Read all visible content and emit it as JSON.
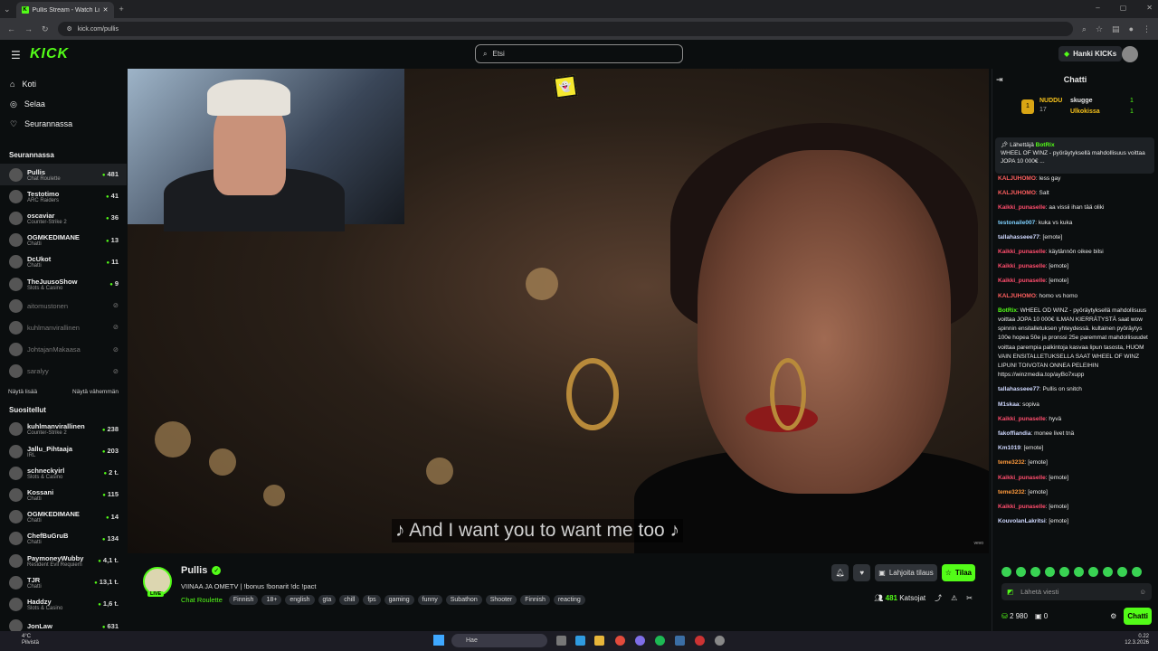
{
  "browser": {
    "tab_title": "Pullis Stream - Watch Live ...",
    "url": "kick.com/pullis"
  },
  "header": {
    "logo": "KICK",
    "search_placeholder": "Etsi",
    "kicks_button": "Hanki KICKs"
  },
  "sidebar": {
    "nav": [
      {
        "label": "Koti",
        "icon": "home-icon"
      },
      {
        "label": "Selaa",
        "icon": "compass-icon"
      },
      {
        "label": "Seurannassa",
        "icon": "heart-icon"
      }
    ],
    "following_header": "Seurannassa",
    "following": [
      {
        "name": "Pullis",
        "sub": "Chat Roulette",
        "count": "481",
        "active": true
      },
      {
        "name": "Testotimo",
        "sub": "ARC Raiders",
        "count": "41"
      },
      {
        "name": "oscaviar",
        "sub": "Counter-Strike 2",
        "count": "36"
      },
      {
        "name": "OGMKEDIMANE",
        "sub": "Chatti",
        "count": "13"
      },
      {
        "name": "DcUkot",
        "sub": "Chatti",
        "count": "11"
      },
      {
        "name": "TheJuusoShow",
        "sub": "Slots & Casino",
        "count": "9"
      },
      {
        "name": "aitomustonen",
        "sub": "",
        "count": "",
        "offline": true
      },
      {
        "name": "kuhlmanvirallinen",
        "sub": "",
        "count": "",
        "offline": true
      },
      {
        "name": "JohtajanMakaasa",
        "sub": "",
        "count": "",
        "offline": true
      },
      {
        "name": "saralyy",
        "sub": "",
        "count": "",
        "offline": true
      }
    ],
    "show_more": "Näytä lisää",
    "show_less": "Näytä vähemmän",
    "recommended_header": "Suositellut",
    "recommended": [
      {
        "name": "kuhlmanvirallinen",
        "sub": "Counter-Strike 2",
        "count": "238"
      },
      {
        "name": "Jallu_Pihtaaja",
        "sub": "IRL",
        "count": "203"
      },
      {
        "name": "schneckyirl",
        "sub": "Slots & Casino",
        "count": "2 t."
      },
      {
        "name": "Kossani",
        "sub": "Chatti",
        "count": "115"
      },
      {
        "name": "OGMKEDIMANE",
        "sub": "Chatti",
        "count": "14"
      },
      {
        "name": "ChefBuGruB",
        "sub": "Chatti",
        "count": "134"
      },
      {
        "name": "PaymoneyWubby",
        "sub": "Resident Evil Requiem",
        "count": "4,1 t."
      },
      {
        "name": "TJR",
        "sub": "Chatti",
        "count": "13,1 t."
      },
      {
        "name": "Haddzy",
        "sub": "Slots & Casino",
        "count": "1,6 t."
      },
      {
        "name": "JonLaw",
        "sub": "",
        "count": "631"
      }
    ]
  },
  "video": {
    "subtitle": "♪ And I want you to want me too ♪",
    "watermark": "vevo"
  },
  "stream": {
    "streamer": "Pullis",
    "title": "VIINAA JA OMETV  |  !bonus !bonarit !dc !pact",
    "category": "Chat Roulette",
    "tags": [
      "Finnish",
      "18+",
      "english",
      "gta",
      "chill",
      "fps",
      "gaming",
      "funny",
      "Subathon",
      "Shooter",
      "Finnish",
      "reacting"
    ],
    "gift_button": "Lahjoita tilaus",
    "subscribe_button": "Tilaa",
    "viewers": "481",
    "viewers_label": "Katsojat",
    "live_badge": "LIVE"
  },
  "chat": {
    "title": "Chatti",
    "gifters": [
      {
        "name": "NUDDU",
        "count": "17"
      },
      {
        "name": "skugge",
        "count": "1"
      },
      {
        "name": "Ulkokissa",
        "count": "1"
      }
    ],
    "pinned_sender_label": "Lähettäjä",
    "pinned_sender": "BotRix",
    "pinned_text": "WHEEL OF WINZ - pyöräytyksellä mahdollisuus voittaa JOPA 10 000€ ...",
    "messages": [
      {
        "user": "KALJUHOMO",
        "color": "#ff5f5f",
        "text": "less gay"
      },
      {
        "user": "KALJUHOMO",
        "color": "#ff5f5f",
        "text": "Salt"
      },
      {
        "user": "Kaikki_punaselle",
        "color": "#ff4d6d",
        "text": "aa vissii ihan tää oliki"
      },
      {
        "user": "testonaile007",
        "color": "#7fd1ff",
        "text": "kuka vs kuka"
      },
      {
        "user": "tallahasseee77",
        "color": "#cfd8ff",
        "text": "[emote]"
      },
      {
        "user": "Kaikki_punaselle",
        "color": "#ff4d6d",
        "text": "käytännön oikee bilsi"
      },
      {
        "user": "Kaikki_punaselle",
        "color": "#ff4d6d",
        "text": "[emote]"
      },
      {
        "user": "Kaikki_punaselle",
        "color": "#ff4d6d",
        "text": "[emote]"
      },
      {
        "user": "KALJUHOMO",
        "color": "#ff5f5f",
        "text": "homo vs homo"
      },
      {
        "user": "BotRix",
        "color": "#53fc18",
        "text": "WHEEL OD WINZ - pyöräytyksellä mahdollisuus voittaa JOPA 10 000€ ILMAN KIERRÄTYSTÄ saat wow spinnin ensitalletuksen yhteydessä. kultainen pyöräytys 100e hopea 50e ja pronssi 25e paremmat mahdollisuudet voittaa parempia palkintoja kasvaa lipun tasosta, HUOM VAIN ENSITALLETUKSELLA SAAT WHEEL OF WINZ LIPUN! TOIVOTAN ONNEA PELEIHIN https://winzmedia.top/ayBo7xupp"
      },
      {
        "user": "tallahasseee77",
        "color": "#cfd8ff",
        "text": "Pullis on snitch"
      },
      {
        "user": "M1skaa",
        "color": "#cfd8ff",
        "text": "sopiva"
      },
      {
        "user": "Kaikki_punaselle",
        "color": "#ff4d6d",
        "text": "hyvä"
      },
      {
        "user": "fakoffiandia",
        "color": "#cfd8ff",
        "text": "monee livet tnä"
      },
      {
        "user": "Km1019",
        "color": "#cfd8ff",
        "text": "[emote]"
      },
      {
        "user": "teme3232",
        "color": "#ff9a3c",
        "text": "[emote]"
      },
      {
        "user": "Kaikki_punaselle",
        "color": "#ff4d6d",
        "text": "[emote]"
      },
      {
        "user": "teme3232",
        "color": "#ff9a3c",
        "text": "[emote]"
      },
      {
        "user": "Kaikki_punaselle",
        "color": "#ff4d6d",
        "text": "[emote]"
      },
      {
        "user": "KouvolanLakritsi",
        "color": "#cfd8ff",
        "text": "[emote]"
      }
    ],
    "input_placeholder": "Lähetä viesti",
    "points": "2 980",
    "gift_count": "0",
    "send_button": "Chatti"
  },
  "taskbar": {
    "weather_temp": "4°C",
    "weather_label": "Pilvistä",
    "search_placeholder": "Hae",
    "time": "0.22",
    "date": "12.3.2026"
  },
  "colors": {
    "accent": "#53fc18",
    "bg": "#0b0e0f"
  }
}
